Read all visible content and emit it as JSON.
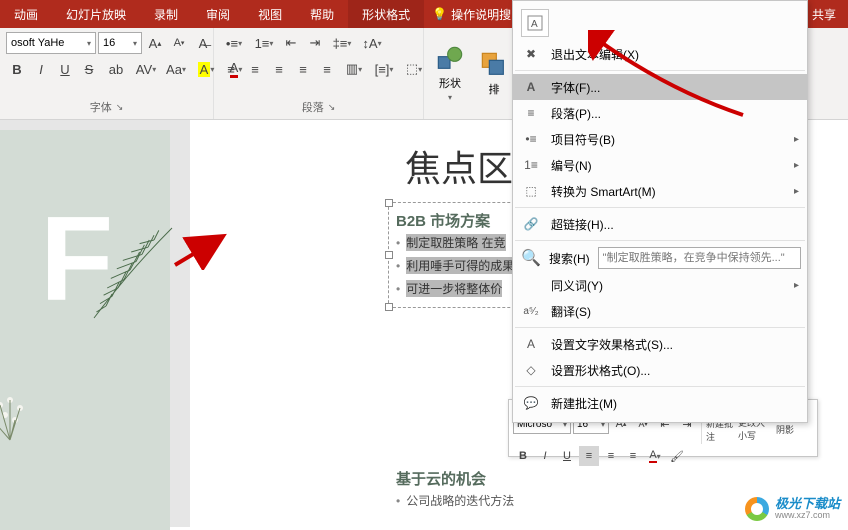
{
  "ribbonTabs": {
    "animation": "动画",
    "slideshow": "幻灯片放映",
    "record": "录制",
    "review": "审阅",
    "view": "视图",
    "help": "帮助",
    "shapeFormat": "形状格式",
    "tellMe": "操作说明搜",
    "share": "共享"
  },
  "ribbon": {
    "fontName": "osoft YaHe",
    "fontSize": "16",
    "fontGroupLabel": "字体",
    "paragraphGroupLabel": "段落",
    "shapes": "形状",
    "arrange": "排"
  },
  "contextMenu": {
    "exitTextEdit": "退出文本编辑(X)",
    "font": "字体(F)...",
    "paragraph": "段落(P)...",
    "bullets": "项目符号(B)",
    "numbering": "编号(N)",
    "convertSmartArt": "转换为 SmartArt(M)",
    "hyperlink": "超链接(H)...",
    "searchLabel": "搜索(H)",
    "searchPlaceholder": "\"制定取胜策略，在竞争中保持领先...\"",
    "synonyms": "同义词(Y)",
    "translate": "翻译(S)",
    "textEffects": "设置文字效果格式(S)...",
    "shapeFormat": "设置形状格式(O)...",
    "newComment": "新建批注(M)"
  },
  "slide": {
    "title": "焦点区",
    "section1Title": "B2B 市场方案",
    "bullets1": [
      "制定取胜策略 在竞",
      "利用唾手可得的成果来确定附加价值",
      "可进一步将整体价"
    ],
    "section2Title": "基于云的机会",
    "bullets2": [
      "公司战略的迭代方法"
    ]
  },
  "miniToolbar": {
    "fontName": "Microso",
    "fontSize": "16",
    "newComment": "新建批注",
    "changeCase": "更改大小写",
    "shadow": "阴影"
  },
  "watermark": {
    "cn": "极光下载站",
    "en": "www.xz7.com"
  },
  "icons": {
    "bold": "B",
    "italic": "I",
    "underline": "U",
    "strike": "S"
  }
}
